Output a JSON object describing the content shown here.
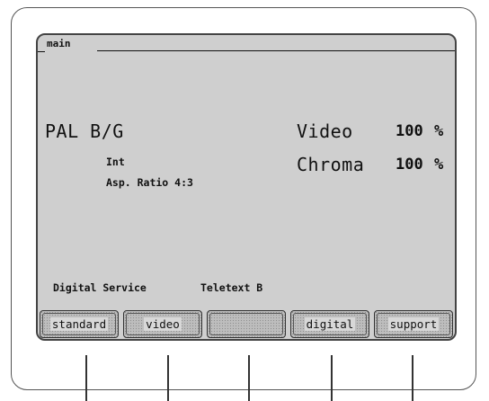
{
  "screen": {
    "tab_label": "main",
    "standard": "PAL B/G",
    "input": "Int",
    "aspect": "Asp. Ratio 4:3",
    "video": {
      "label": "Video",
      "value": "100",
      "unit": "%"
    },
    "chroma": {
      "label": "Chroma",
      "value": "100",
      "unit": "%"
    },
    "status_left": "Digital Service",
    "status_right": "Teletext B"
  },
  "softkeys": [
    {
      "label": "standard"
    },
    {
      "label": "video"
    },
    {
      "label": ""
    },
    {
      "label": "digital"
    },
    {
      "label": "support"
    }
  ],
  "colors": {
    "screen_bg": "#cfcfcf",
    "button_bg": "#bdbdbd",
    "text": "#111111"
  }
}
